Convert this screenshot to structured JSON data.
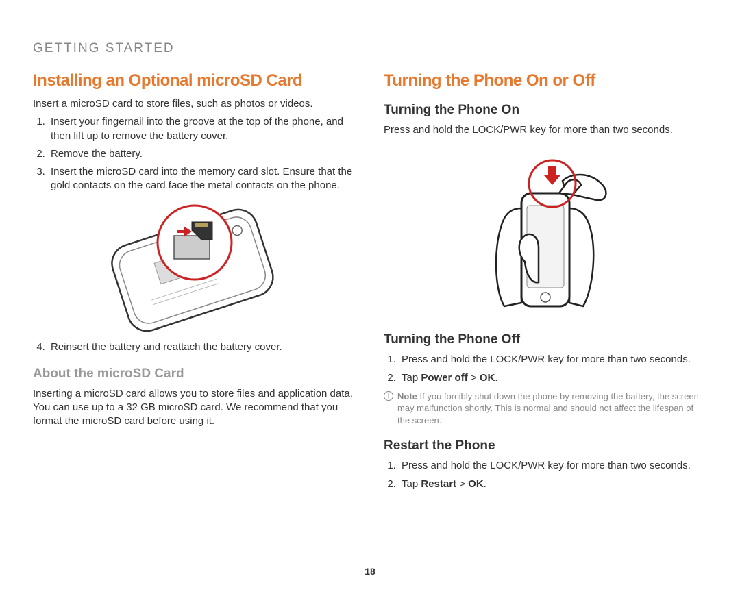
{
  "header": "GETTING STARTED",
  "left": {
    "title": "Installing an Optional microSD Card",
    "intro": "Insert a microSD card to store files, such as photos or videos.",
    "steps_a": {
      "s1": "Insert your fingernail into the groove at the top of the phone, and then lift up to remove the battery cover.",
      "s2": "Remove the battery.",
      "s3": "Insert the microSD card into the memory card slot. Ensure that the gold contacts on the card face the metal contacts on the phone."
    },
    "steps_b": {
      "s4": "Reinsert the battery and reattach the battery cover."
    },
    "about_heading": "About the microSD Card",
    "about_body": "Inserting a microSD card allows you to store files and application data. You can use up to a 32 GB microSD card. We recommend that you format the microSD card before using it."
  },
  "right": {
    "title": "Turning the Phone On or Off",
    "on_heading": "Turning the Phone On",
    "on_body": "Press and hold the LOCK/PWR key for more than two seconds.",
    "off_heading": "Turning the Phone Off",
    "off_steps": {
      "s1": "Press and hold the LOCK/PWR key for more than two seconds.",
      "s2_pre": "Tap ",
      "s2_bold": "Power off",
      "s2_mid": " > ",
      "s2_bold2": "OK",
      "s2_post": "."
    },
    "note_label": "Note",
    "note_body": " If you forcibly shut down the phone by removing the battery, the screen may malfunction shortly. This is normal and should not affect the lifespan of the screen.",
    "restart_heading": "Restart the Phone",
    "restart_steps": {
      "s1": "Press and hold the LOCK/PWR key for more than two seconds.",
      "s2_pre": "Tap ",
      "s2_bold": "Restart",
      "s2_mid": " > ",
      "s2_bold2": "OK",
      "s2_post": "."
    }
  },
  "page_number": "18"
}
